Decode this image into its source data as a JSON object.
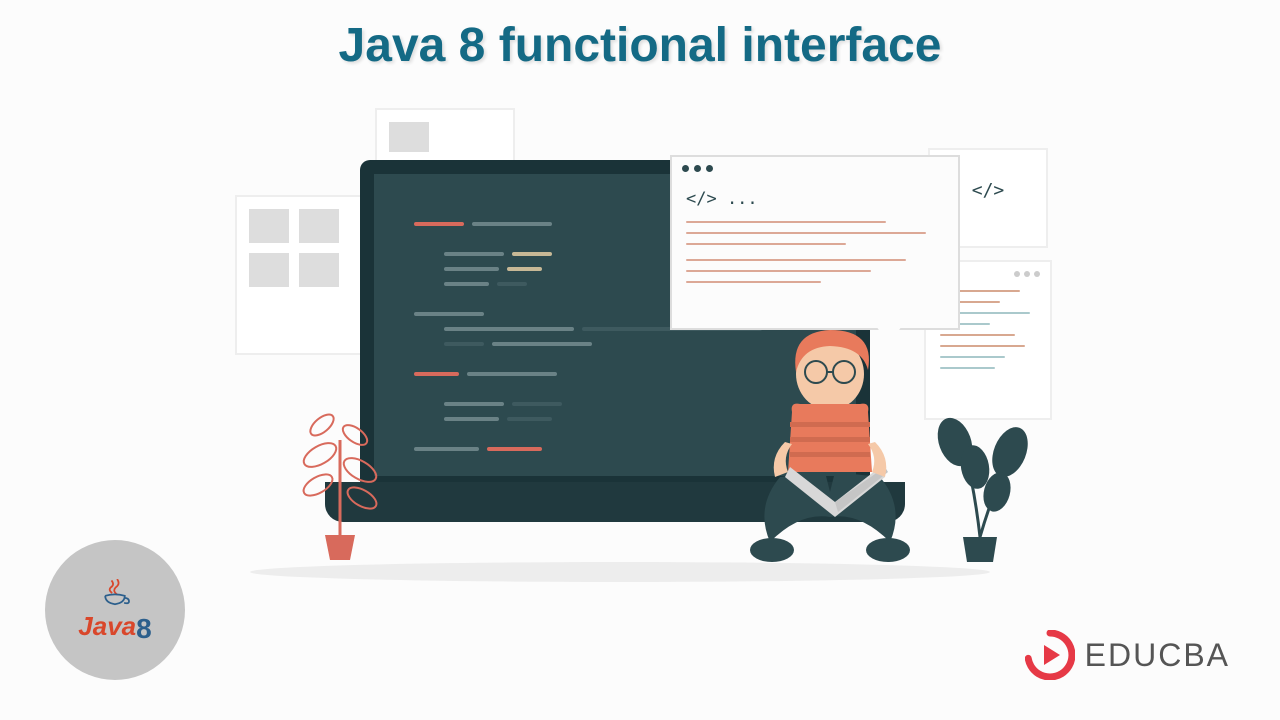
{
  "title": "Java 8 functional interface",
  "speech_tag": "</> ...",
  "right_tag": "</>",
  "java_badge": {
    "text": "Java",
    "version": "8"
  },
  "educba": {
    "text": "EDUCBA"
  }
}
